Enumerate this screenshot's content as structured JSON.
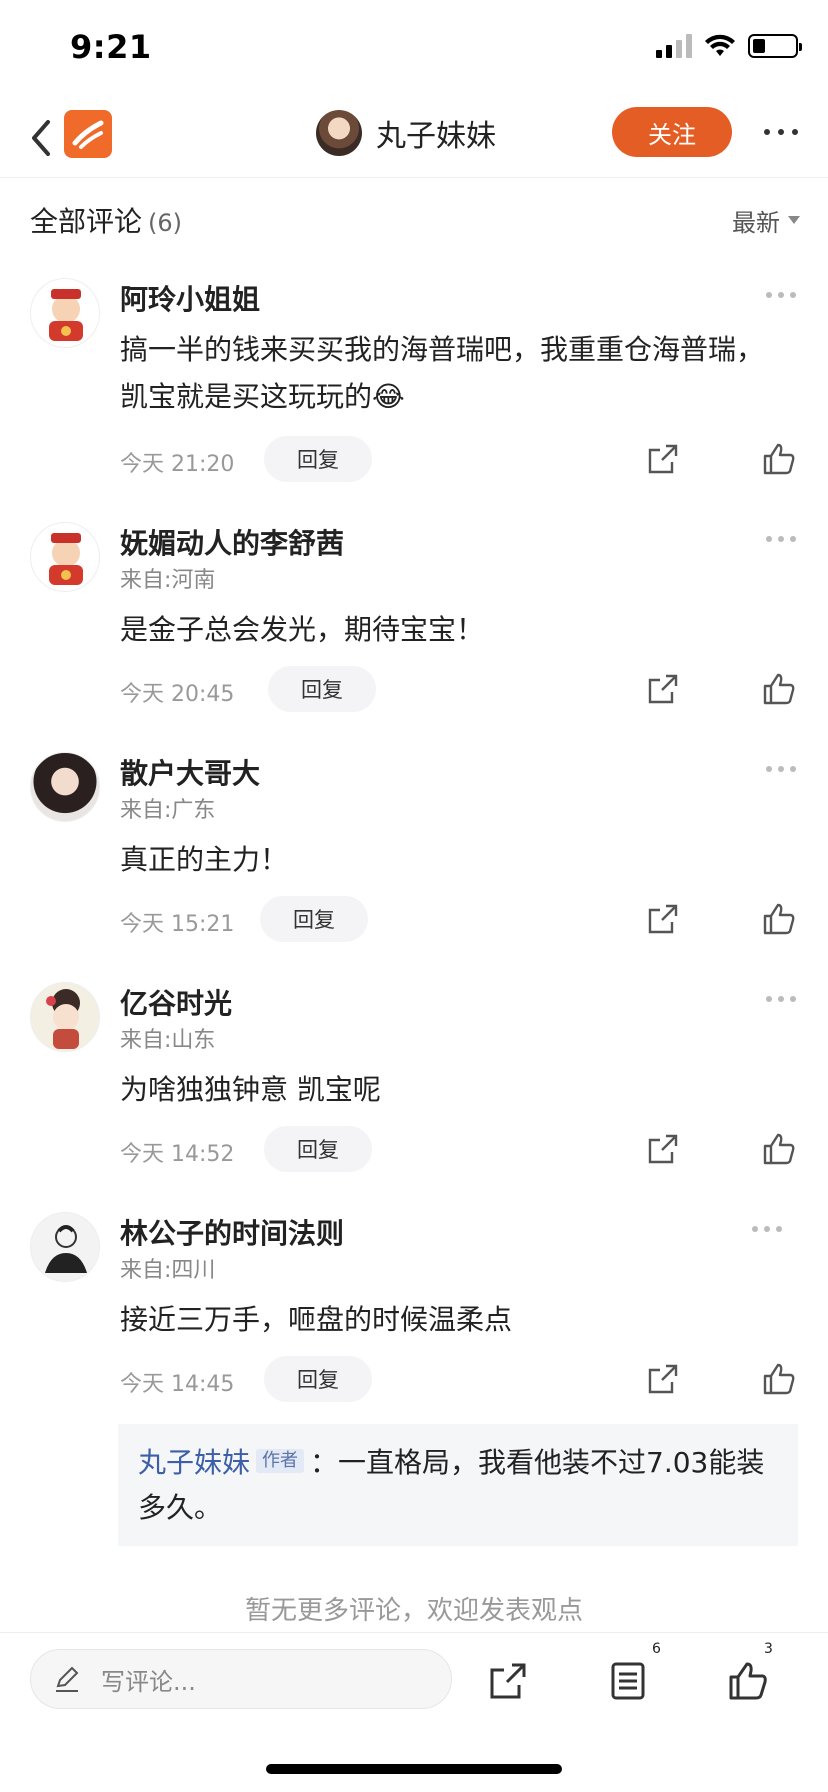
{
  "status_bar": {
    "time": "9:21",
    "battery_level": 0.3
  },
  "header": {
    "user_name": "丸子妹妹",
    "follow_label": "关注",
    "accent_color": "#e45d24"
  },
  "comments_section": {
    "title": "全部评论",
    "count": "(6)",
    "sort_label": "最新"
  },
  "comments": [
    {
      "name": "阿玲小姐姐",
      "location": "",
      "text": "搞一半的钱来买买我的海普瑞吧，我重重仓海普瑞，凯宝就是买这玩玩的😂",
      "time": "今天 21:20",
      "reply_label": "回复",
      "avatar_icon": "caishen-avatar"
    },
    {
      "name": "妩媚动人的李舒茜",
      "location": "来自:河南",
      "text": "是金子总会发光，期待宝宝！",
      "time": "今天 20:45",
      "reply_label": "回复",
      "avatar_icon": "caishen-avatar"
    },
    {
      "name": "散户大哥大",
      "location": "来自:广东",
      "text": "真正的主力！",
      "time": "今天 15:21",
      "reply_label": "回复",
      "avatar_icon": "woman-photo-avatar"
    },
    {
      "name": "亿谷时光",
      "location": "来自:山东",
      "text": "为啥独独钟意 凯宝呢",
      "time": "今天 14:52",
      "reply_label": "回复",
      "avatar_icon": "cartoon-girl-avatar"
    },
    {
      "name": "林公子的时间法则",
      "location": "来自:四川",
      "text": "接近三万手，咂盘的时候温柔点",
      "time": "今天 14:45",
      "reply_label": "回复",
      "avatar_icon": "sketch-avatar"
    }
  ],
  "author_reply": {
    "name": "丸子妹妹",
    "badge": "作者",
    "separator": "：",
    "text": "一直格局，我看他装不过7.03能装多久。"
  },
  "no_more_text": "暂无更多评论，欢迎发表观点",
  "bottom_bar": {
    "input_placeholder": "写评论...",
    "comments_badge": "6",
    "likes_badge": "3"
  }
}
